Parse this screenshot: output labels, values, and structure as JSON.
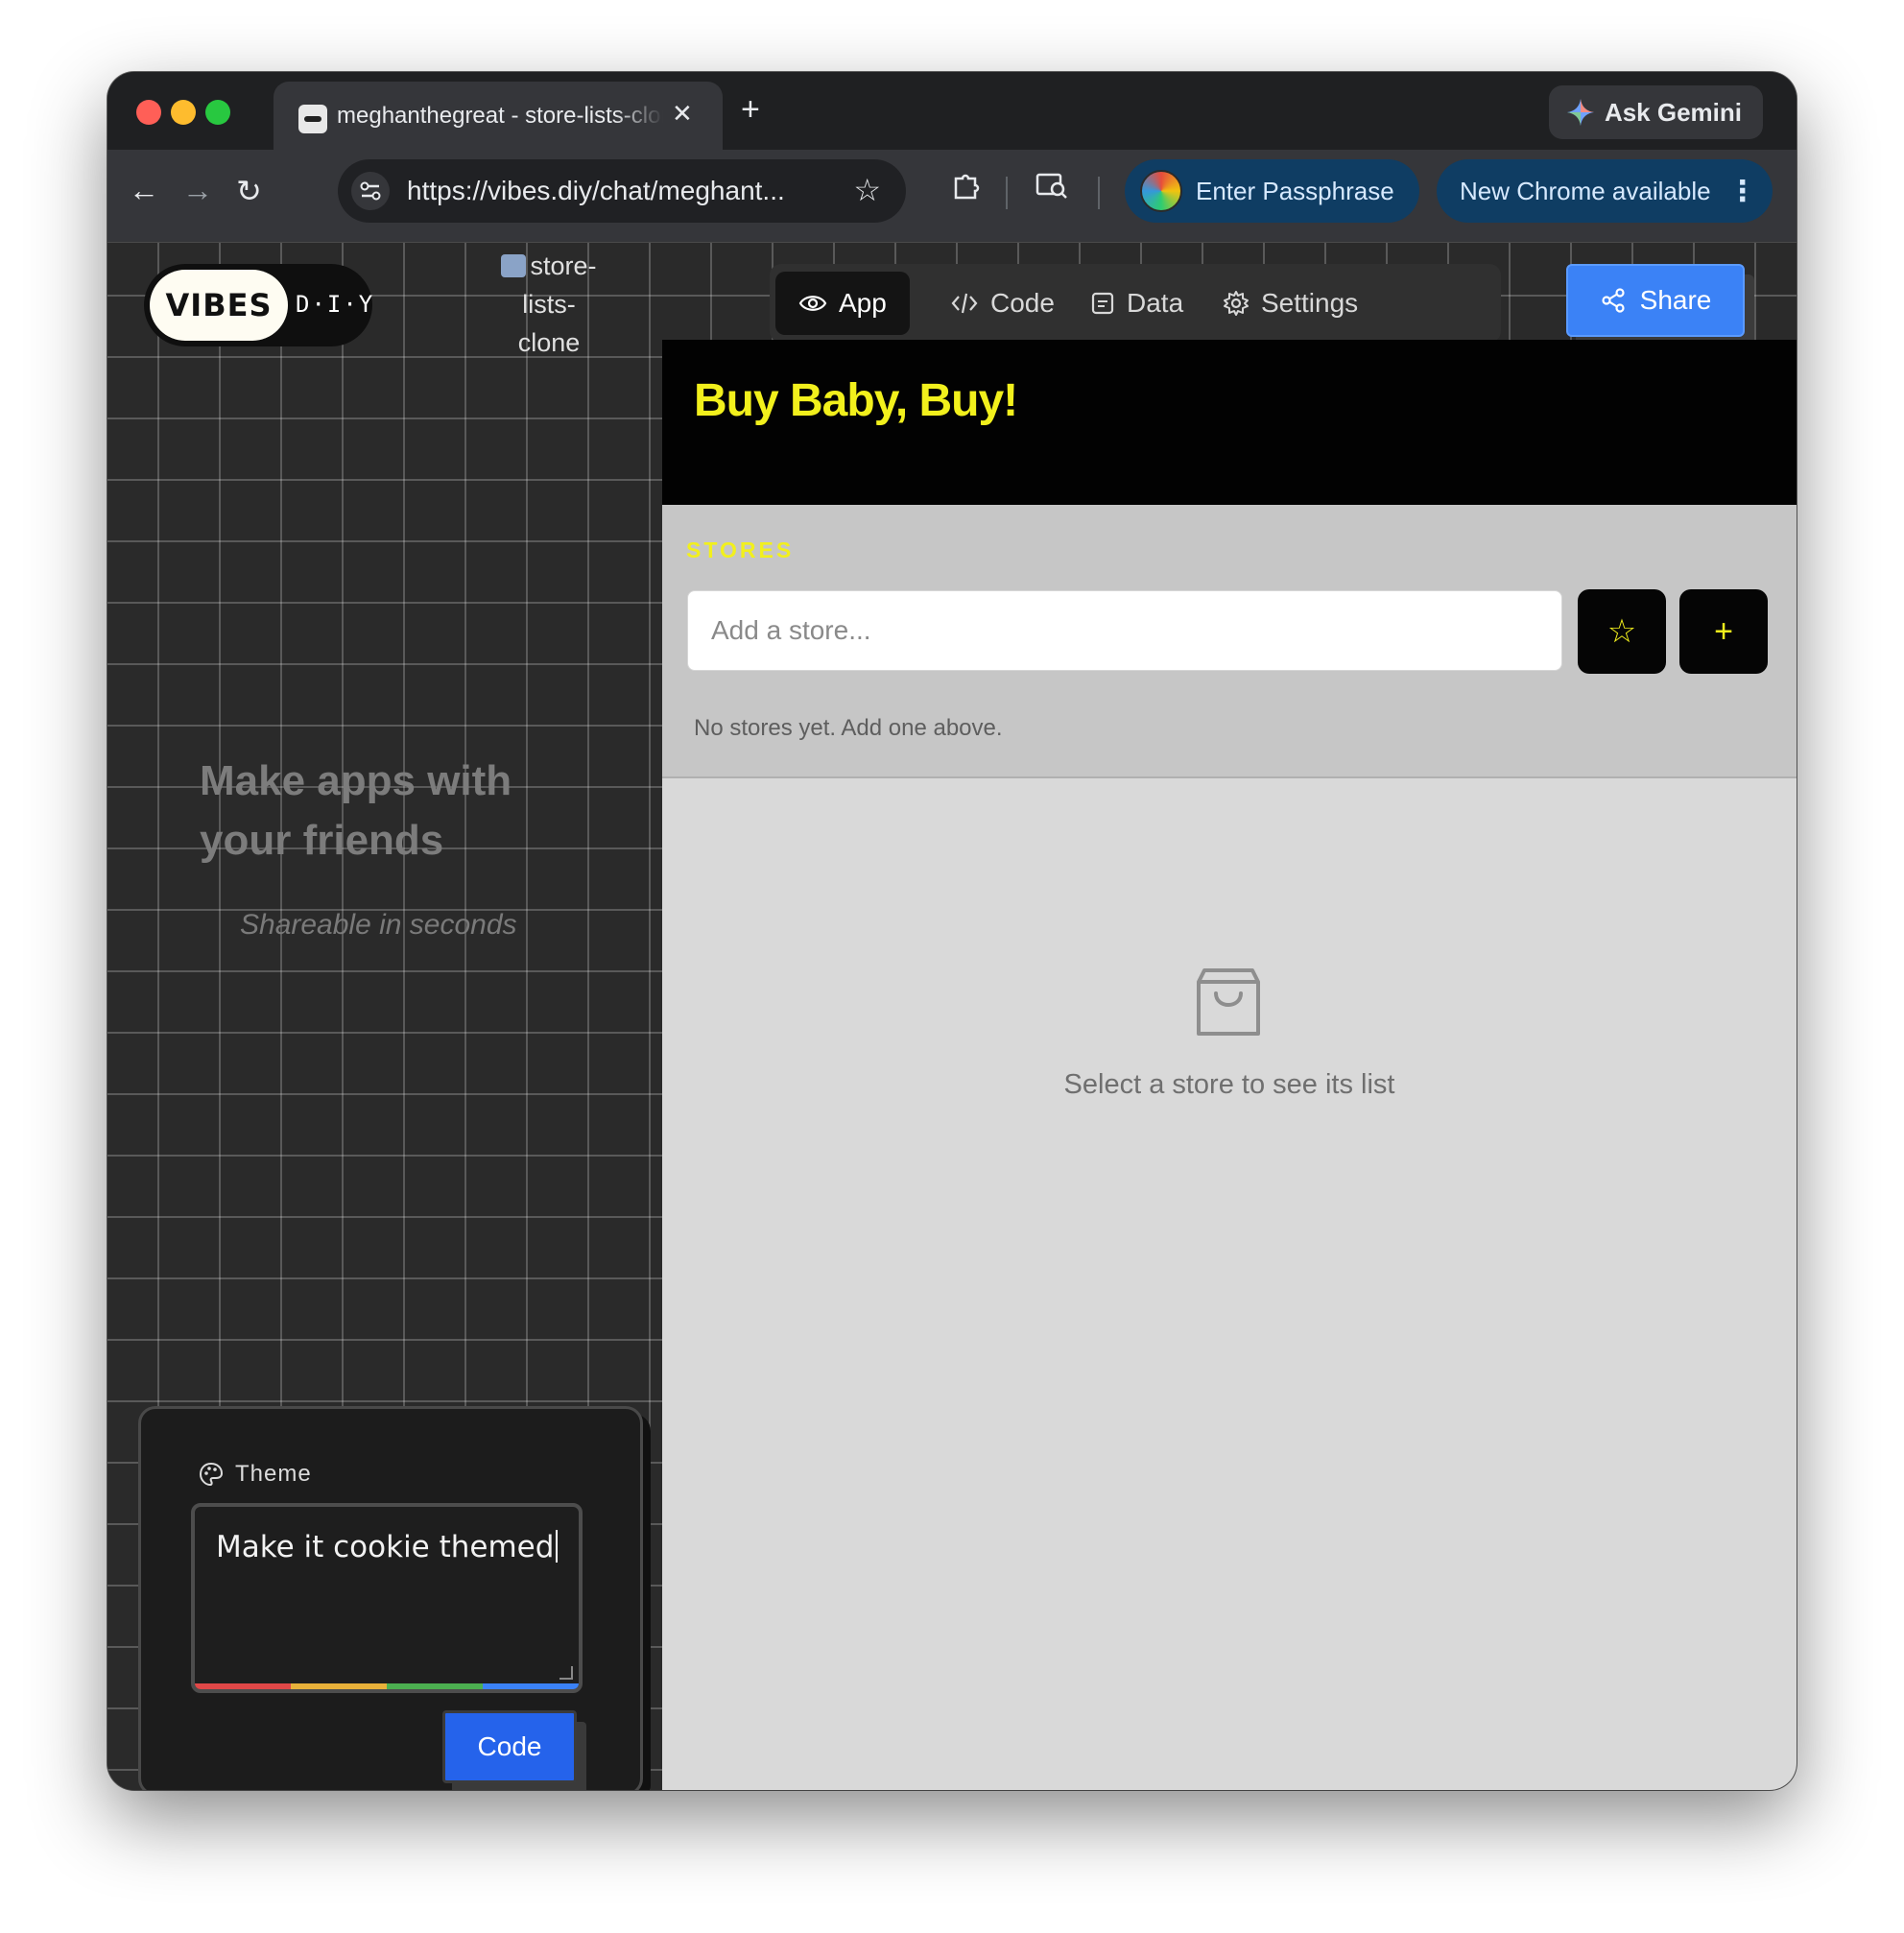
{
  "browser": {
    "tab_title": "meghanthegreat - store-lists-clone",
    "tab_close": "✕",
    "new_tab": "+",
    "ask_gemini": "Ask Gemini",
    "url": "https://vibes.diy/chat/meghant...",
    "enter_passphrase": "Enter Passphrase",
    "new_chrome": "New Chrome available",
    "traffic_lights": [
      "#ff5f57",
      "#febc2e",
      "#28c840"
    ]
  },
  "header": {
    "logo_main": "VIBES",
    "logo_sub": "D·I·Y",
    "project_title": "store-lists-clone",
    "tabs": [
      {
        "label": "App",
        "icon": "eye-icon"
      },
      {
        "label": "Code",
        "icon": "code-icon"
      },
      {
        "label": "Data",
        "icon": "data-icon"
      },
      {
        "label": "Settings",
        "icon": "gear-icon"
      }
    ],
    "share_label": "Share"
  },
  "sidebar": {
    "hero_title": "Make apps with your friends",
    "hero_subtitle": "Shareable in seconds",
    "theme_label": "Theme",
    "theme_value": "Make it cookie themed",
    "code_button": "Code"
  },
  "app": {
    "title": "Buy Baby, Buy!",
    "stores_heading": "STORES",
    "store_placeholder": "Add a store...",
    "favorite_button": "☆",
    "add_button": "+",
    "empty_stores": "No stores yet. Add one above.",
    "select_store_msg": "Select a store to see its list",
    "accent_color": "#f2f01c"
  }
}
